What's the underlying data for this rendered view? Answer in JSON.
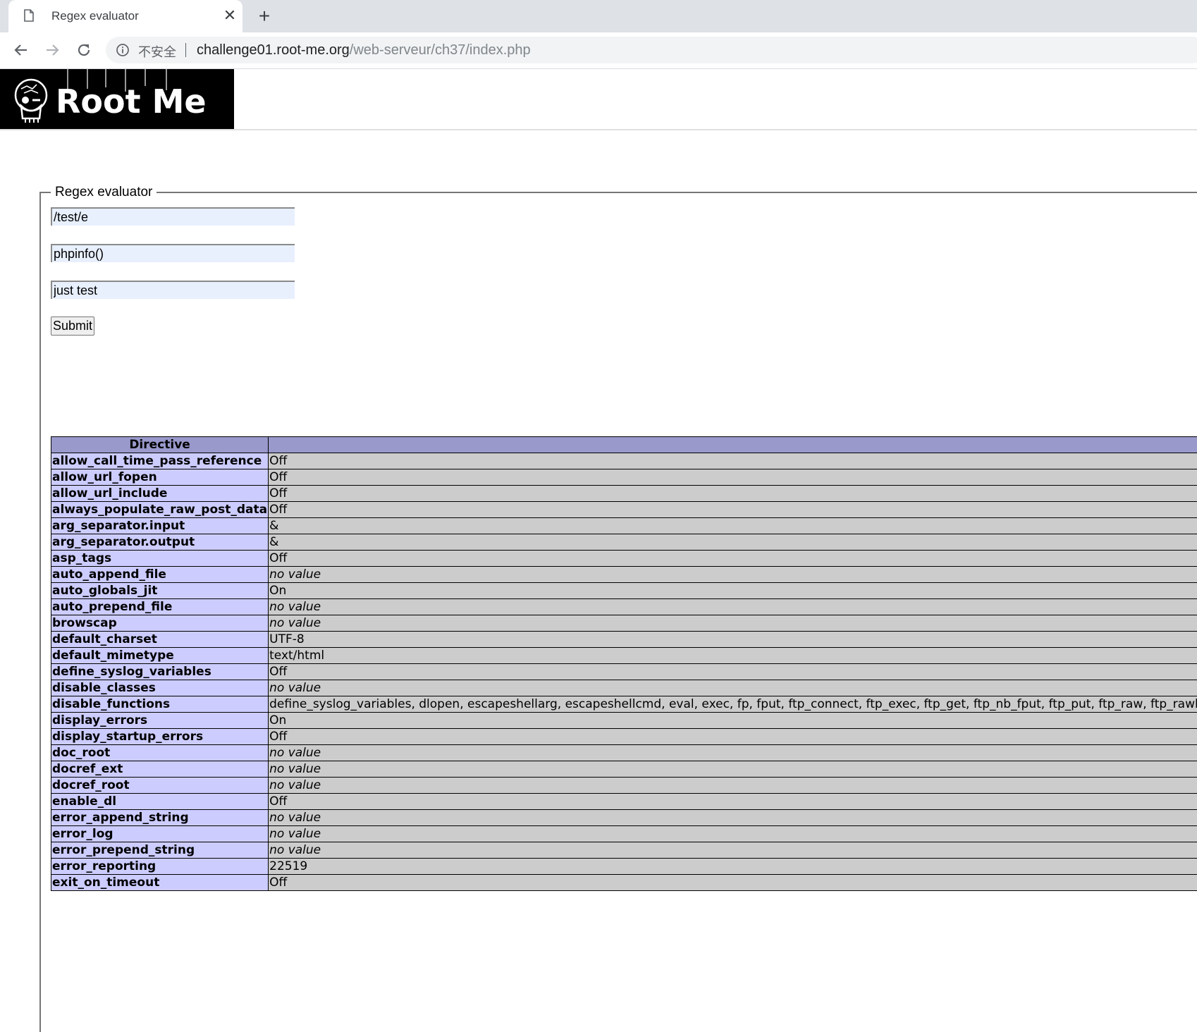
{
  "browser": {
    "tab_title": "Regex evaluator",
    "close_glyph": "✕",
    "new_tab_glyph": "+",
    "security_label": "不安全",
    "url_host": "challenge01.root-me.org",
    "url_path": "/web-serveur/ch37/index.php"
  },
  "page": {
    "logo_text": "Root Me",
    "form": {
      "legend": "Regex evaluator",
      "search_value": "/test/e",
      "replace_value": "phpinfo()",
      "content_value": "just test",
      "submit_label": "Submit"
    },
    "phpinfo": {
      "header_directive": "Directive",
      "header_value": "",
      "rows": [
        {
          "key": "allow_call_time_pass_reference",
          "value": "Off"
        },
        {
          "key": "allow_url_fopen",
          "value": "Off"
        },
        {
          "key": "allow_url_include",
          "value": "Off"
        },
        {
          "key": "always_populate_raw_post_data",
          "value": "Off"
        },
        {
          "key": "arg_separator.input",
          "value": "&"
        },
        {
          "key": "arg_separator.output",
          "value": "&"
        },
        {
          "key": "asp_tags",
          "value": "Off"
        },
        {
          "key": "auto_append_file",
          "value": "no value"
        },
        {
          "key": "auto_globals_jit",
          "value": "On"
        },
        {
          "key": "auto_prepend_file",
          "value": "no value"
        },
        {
          "key": "browscap",
          "value": "no value"
        },
        {
          "key": "default_charset",
          "value": "UTF-8"
        },
        {
          "key": "default_mimetype",
          "value": "text/html"
        },
        {
          "key": "define_syslog_variables",
          "value": "Off"
        },
        {
          "key": "disable_classes",
          "value": "no value"
        },
        {
          "key": "disable_functions",
          "value": "define_syslog_variables, dlopen, escapeshellarg, escapeshellcmd, eval, exec, fp, fput, ftp_connect, ftp_exec, ftp_get, ftp_nb_fput, ftp_put, ftp_raw, ftp_rawlist"
        },
        {
          "key": "display_errors",
          "value": "On"
        },
        {
          "key": "display_startup_errors",
          "value": "Off"
        },
        {
          "key": "doc_root",
          "value": "no value"
        },
        {
          "key": "docref_ext",
          "value": "no value"
        },
        {
          "key": "docref_root",
          "value": "no value"
        },
        {
          "key": "enable_dl",
          "value": "Off"
        },
        {
          "key": "error_append_string",
          "value": "no value"
        },
        {
          "key": "error_log",
          "value": "no value"
        },
        {
          "key": "error_prepend_string",
          "value": "no value"
        },
        {
          "key": "error_reporting",
          "value": "22519"
        },
        {
          "key": "exit_on_timeout",
          "value": "Off"
        }
      ]
    }
  }
}
